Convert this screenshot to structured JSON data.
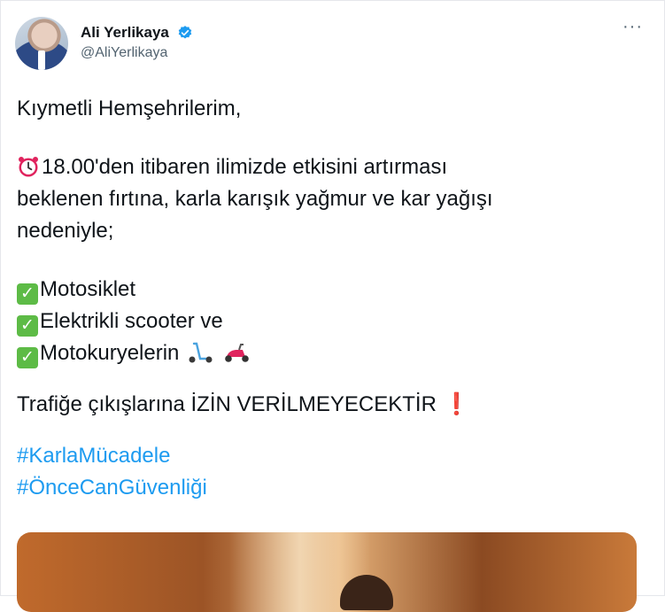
{
  "tweet": {
    "author": {
      "display_name": "Ali Yerlikaya",
      "handle": "@AliYerlikaya",
      "verified_icon": "verified-badge-icon",
      "avatar_icon": "profile-photo"
    },
    "more_label": "···",
    "greeting": "Kıymetli Hemşehrilerim,",
    "paragraph": {
      "icon": "alarm-clock-emoji",
      "line1": "18.00'den itibaren ilimizde etkisini artırması",
      "line2": "beklenen fırtına, karla karışık yağmur ve kar yağışı",
      "line3": "nedeniyle;"
    },
    "items": [
      {
        "check": "✓",
        "label": "Motosiklet"
      },
      {
        "check": "✓",
        "label": "Elektrikli scooter ve"
      },
      {
        "check": "✓",
        "label": "Motokuryelerin"
      }
    ],
    "item_icons": [
      "kick-scooter-emoji",
      "motor-scooter-emoji"
    ],
    "notice": "Trafiğe çıkışlarına İZİN VERİLMEYECEKTİR",
    "notice_mark": "❗",
    "hashtags": [
      "#KarlaMücadele",
      "#ÖnceCanGüvenliği"
    ],
    "colors": {
      "hashtag": "#1d9bf0",
      "verified": "#1d9bf0",
      "check_box": "#5dbb46",
      "exclaim": "#e0245e"
    }
  }
}
